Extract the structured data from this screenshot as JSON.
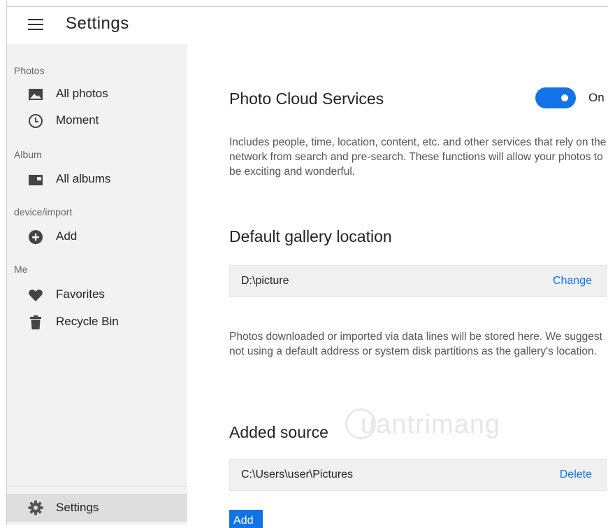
{
  "header": {
    "title": "Settings"
  },
  "sidebar": {
    "sections": [
      {
        "label": "Photos",
        "items": [
          {
            "label": "All photos",
            "icon": "image-icon"
          },
          {
            "label": "Moment",
            "icon": "clock-icon"
          }
        ]
      },
      {
        "label": "Album",
        "items": [
          {
            "label": "All albums",
            "icon": "album-icon"
          }
        ]
      },
      {
        "label": "device/import",
        "items": [
          {
            "label": "Add",
            "icon": "plus-circle-icon"
          }
        ]
      },
      {
        "label": "Me",
        "items": [
          {
            "label": "Favorites",
            "icon": "heart-icon"
          },
          {
            "label": "Recycle Bin",
            "icon": "trash-icon"
          }
        ]
      }
    ],
    "settings": {
      "label": "Settings",
      "icon": "gear-icon"
    }
  },
  "main": {
    "cloud": {
      "title": "Photo Cloud Services",
      "toggle_state": "On",
      "description": "Includes people, time, location, content, etc. and other services that rely on the network from search and pre-search. These functions will allow your photos to be exciting and wonderful."
    },
    "gallery": {
      "title": "Default gallery location",
      "path": "D:\\picture",
      "action": "Change",
      "description": "Photos downloaded or imported via data lines will be stored here. We suggest not using a default address or system disk partitions as the gallery's location."
    },
    "sources": {
      "title": "Added source",
      "path": "C:\\Users\\user\\Pictures",
      "action": "Delete",
      "add_label": "Add"
    }
  },
  "watermark": {
    "text": "uantrimang"
  },
  "colors": {
    "accent": "#1273e6",
    "sidebar_bg": "#f2f2f2",
    "selected_bg": "#dedede"
  }
}
